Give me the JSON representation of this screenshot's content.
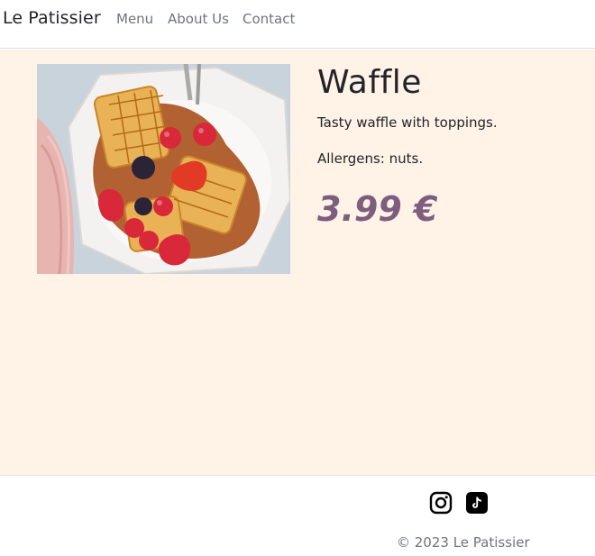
{
  "navbar": {
    "brand": "Le Patissier",
    "links": [
      "Menu",
      "About Us",
      "Contact"
    ]
  },
  "product": {
    "title": "Waffle",
    "description": "Tasty waffle with toppings.",
    "allergens": "Allergens: nuts.",
    "price": "3.99 €",
    "image_icon": "waffle-photo"
  },
  "footer": {
    "social": [
      {
        "icon": "instagram-icon"
      },
      {
        "icon": "tiktok-icon"
      }
    ],
    "copyright": "© 2023 Le Patissier"
  },
  "colors": {
    "main_background": "#fff2e6",
    "price": "#7e5e7f",
    "nav_link": "#6c757d"
  }
}
